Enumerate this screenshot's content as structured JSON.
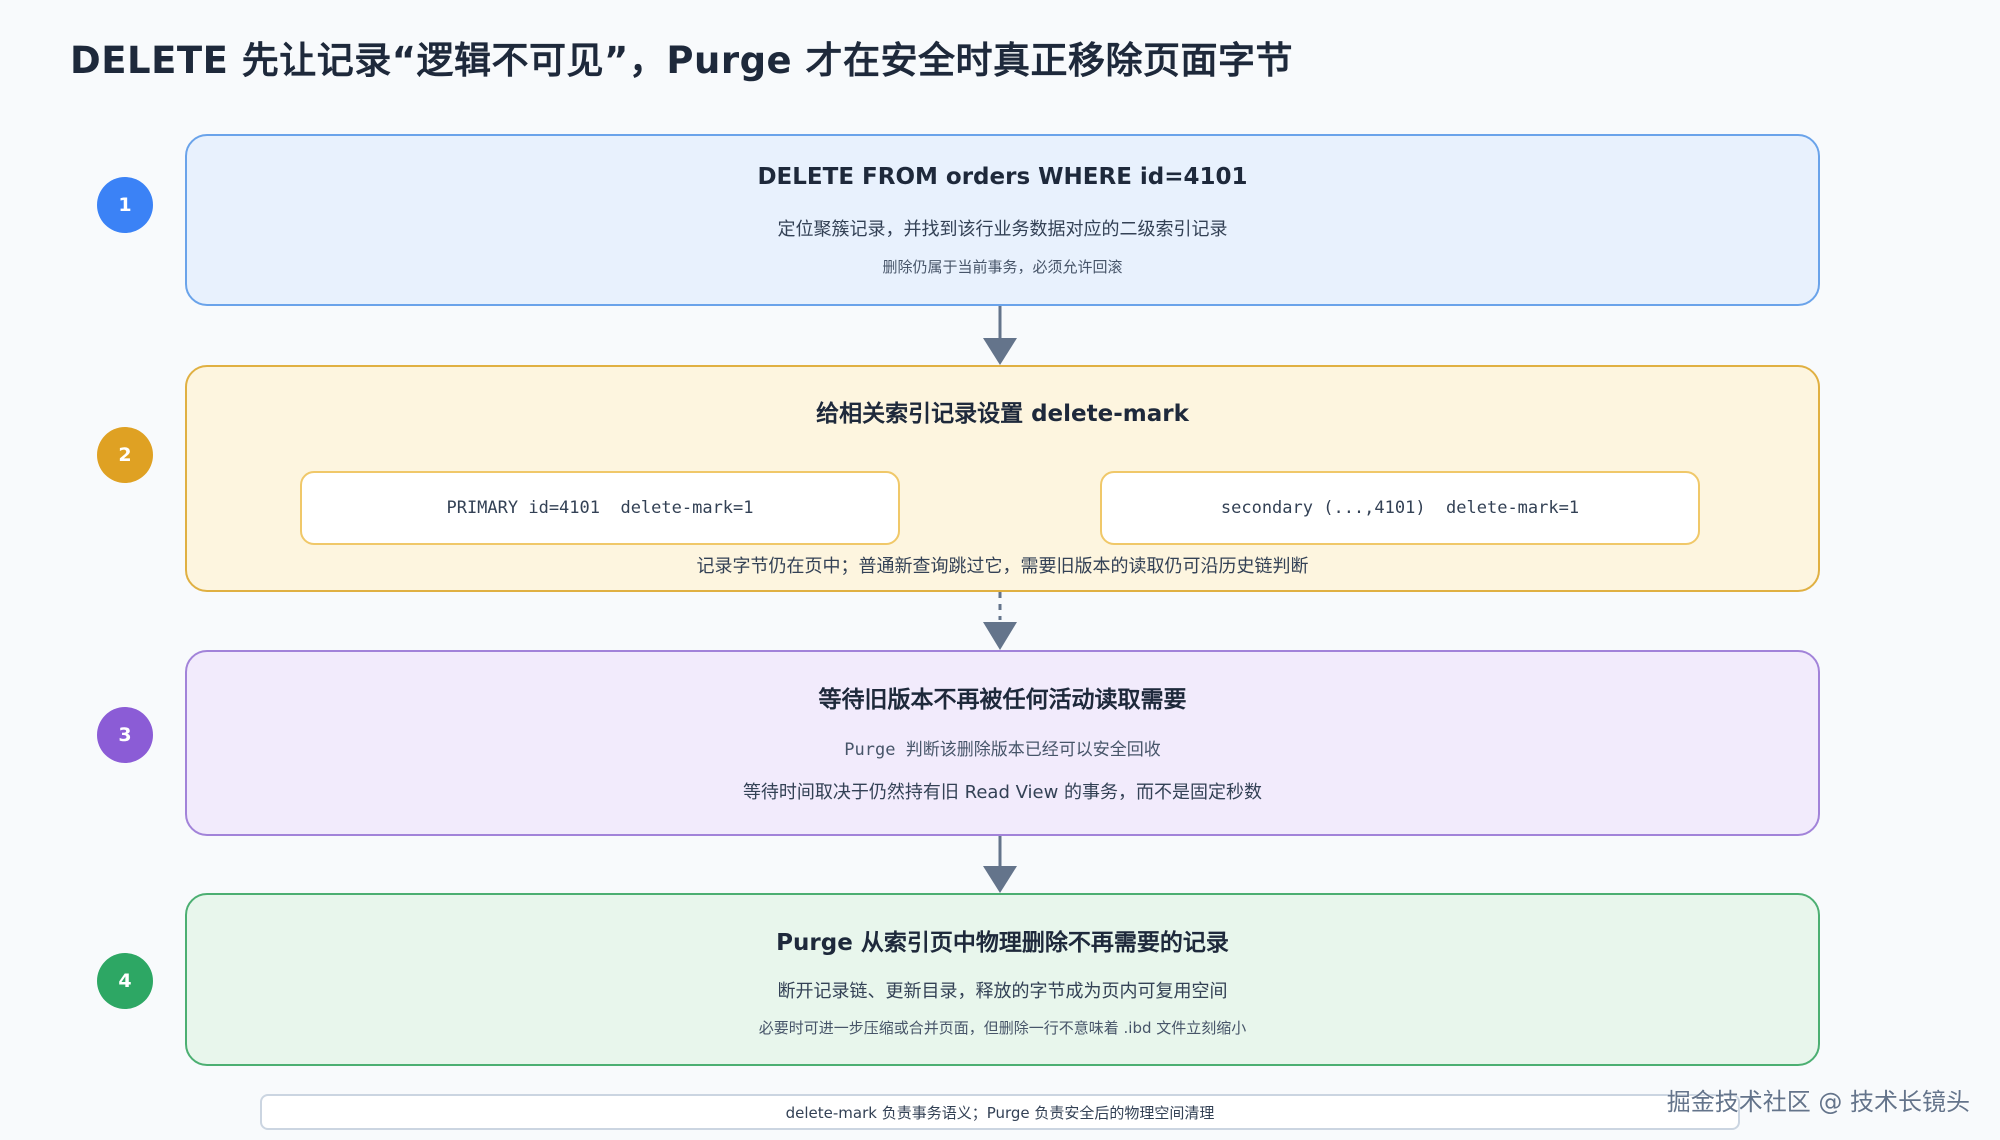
{
  "title": "DELETE 先让记录“逻辑不可见”，Purge 才在安全时真正移除页面字节",
  "steps": [
    {
      "number": "1",
      "heading": "DELETE FROM orders WHERE id=4101",
      "line1": "定位聚簇记录，并找到该行业务数据对应的二级索引记录",
      "line2": "删除仍属于当前事务，必须允许回滚",
      "badge_color": "#3b82f6",
      "fill": "#e8f1fd",
      "border": "#6aa3ea"
    },
    {
      "number": "2",
      "heading": "给相关索引记录设置 delete-mark",
      "primary_record": "PRIMARY id=4101  delete-mark=1",
      "secondary_record": "secondary (...,4101)  delete-mark=1",
      "note": "记录字节仍在页中；普通新查询跳过它，需要旧版本的读取仍可沿历史链判断",
      "badge_color": "#dfa123",
      "fill": "#fdf5df",
      "border": "#e0b042"
    },
    {
      "number": "3",
      "heading": "等待旧版本不再被任何活动读取需要",
      "line1": "Purge 判断该删除版本已经可以安全回收",
      "line2": "等待时间取决于仍然持有旧 Read View 的事务，而不是固定秒数",
      "badge_color": "#8b5cd6",
      "fill": "#f2ebfc",
      "border": "#a283d9"
    },
    {
      "number": "4",
      "heading": "Purge 从索引页中物理删除不再需要的记录",
      "line1": "断开记录链、更新目录，释放的字节成为页内可复用空间",
      "line2": "必要时可进一步压缩或合并页面，但删除一行不意味着 .ibd 文件立刻缩小",
      "badge_color": "#2da764",
      "fill": "#e8f6ec",
      "border": "#4caf72"
    }
  ],
  "footer": "delete-mark 负责事务语义；Purge 负责安全后的物理空间清理",
  "watermark": "掘金技术社区 @ 技术长镜头",
  "colors": {
    "arrow": "#64748b"
  }
}
